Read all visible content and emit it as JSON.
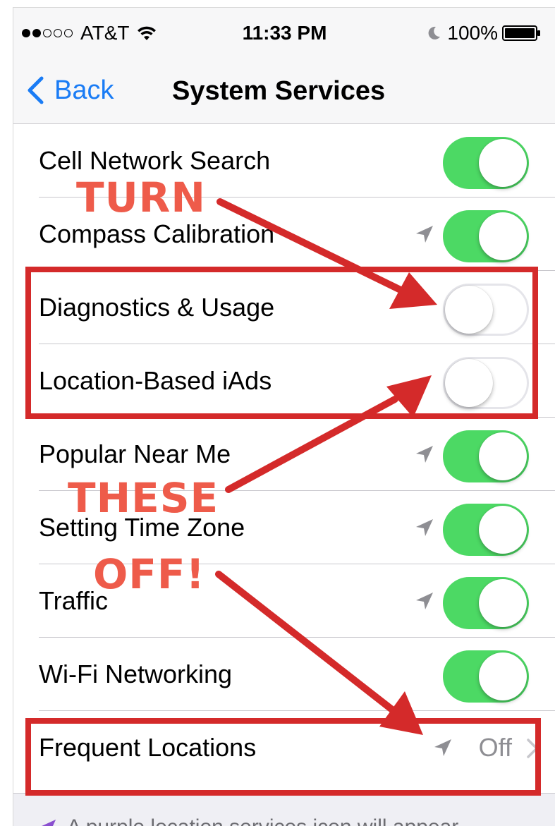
{
  "status_bar": {
    "carrier": "AT&T",
    "signal_full": 2,
    "signal_empty": 3,
    "time": "11:33 PM",
    "battery": "100%"
  },
  "nav": {
    "back_label": "Back",
    "title": "System Services"
  },
  "rows": [
    {
      "label": "Cell Network Search",
      "on": true,
      "location_icon": false
    },
    {
      "label": "Compass Calibration",
      "on": true,
      "location_icon": true
    },
    {
      "label": "Diagnostics & Usage",
      "on": false,
      "location_icon": false
    },
    {
      "label": "Location-Based iAds",
      "on": false,
      "location_icon": false
    },
    {
      "label": "Popular Near Me",
      "on": true,
      "location_icon": true
    },
    {
      "label": "Setting Time Zone",
      "on": true,
      "location_icon": true
    },
    {
      "label": "Traffic",
      "on": true,
      "location_icon": true
    },
    {
      "label": "Wi-Fi Networking",
      "on": true,
      "location_icon": false
    }
  ],
  "frequent_locations": {
    "label": "Frequent Locations",
    "value": "Off"
  },
  "footer": {
    "text": "A purple location services icon will appear"
  },
  "annotations": {
    "word1": "TURN",
    "word2": "THESE",
    "word3": "OFF!"
  },
  "colors": {
    "toggle_on": "#4cd964",
    "accent_blue": "#1a7cf5",
    "annotation_red": "#d42a2a",
    "annotation_text": "#ee5b4a"
  }
}
